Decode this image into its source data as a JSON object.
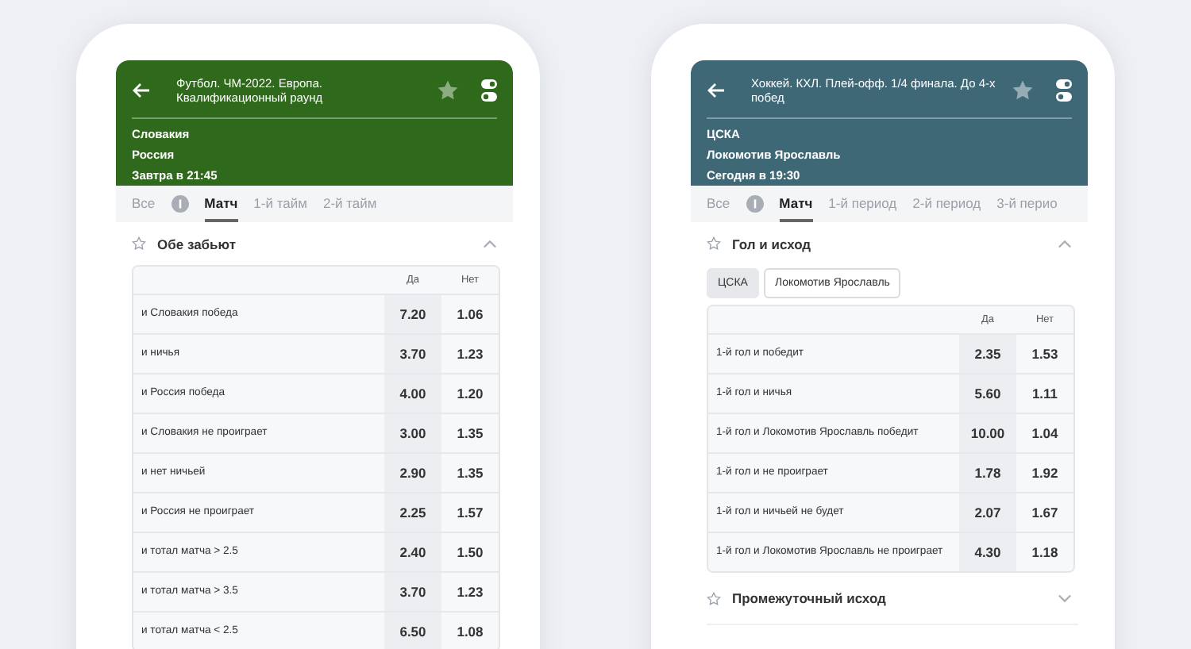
{
  "phones": [
    {
      "header": {
        "color": "#2f6a1c",
        "title": "Футбол. ЧМ-2022. Европа. Квалификационный раунд",
        "teams": [
          "Словакия",
          "Россия"
        ],
        "time": "Завтра в 21:45"
      },
      "tabs": [
        {
          "kind": "text",
          "label": "Все",
          "selected": false
        },
        {
          "kind": "icon",
          "selected": false
        },
        {
          "kind": "text",
          "label": "Матч",
          "selected": true
        },
        {
          "kind": "text",
          "label": "1-й тайм",
          "selected": false
        },
        {
          "kind": "text",
          "label": "2-й тайм",
          "selected": false
        }
      ],
      "sections": [
        {
          "title": "Обе забьют",
          "expanded": true,
          "table": {
            "columns": [
              "Да",
              "Нет"
            ],
            "rows": [
              {
                "label": "и Словакия победа",
                "values": [
                  "7.20",
                  "1.06"
                ]
              },
              {
                "label": "и ничья",
                "values": [
                  "3.70",
                  "1.23"
                ]
              },
              {
                "label": "и Россия победа",
                "values": [
                  "4.00",
                  "1.20"
                ]
              },
              {
                "label": "и Словакия не проиграет",
                "values": [
                  "3.00",
                  "1.35"
                ]
              },
              {
                "label": "и нет ничьей",
                "values": [
                  "2.90",
                  "1.35"
                ]
              },
              {
                "label": "и Россия не проиграет",
                "values": [
                  "2.25",
                  "1.57"
                ]
              },
              {
                "label": "и тотал матча > 2.5",
                "values": [
                  "2.40",
                  "1.50"
                ]
              },
              {
                "label": "и тотал матча > 3.5",
                "values": [
                  "3.70",
                  "1.23"
                ]
              },
              {
                "label": "и тотал матча < 2.5",
                "values": [
                  "6.50",
                  "1.08"
                ]
              }
            ]
          }
        }
      ]
    },
    {
      "header": {
        "color": "#3f6877",
        "title": "Хоккей. КХЛ. Плей-офф. 1/4 финала. До 4-х побед",
        "teams": [
          "ЦСКА",
          "Локомотив Ярославль"
        ],
        "time": "Сегодня в 19:30"
      },
      "tabs": [
        {
          "kind": "text",
          "label": "Все",
          "selected": false
        },
        {
          "kind": "icon",
          "selected": false
        },
        {
          "kind": "text",
          "label": "Матч",
          "selected": true
        },
        {
          "kind": "text",
          "label": "1-й период",
          "selected": false
        },
        {
          "kind": "text",
          "label": "2-й период",
          "selected": false
        },
        {
          "kind": "text",
          "label": "3-й перио",
          "selected": false
        }
      ],
      "sections": [
        {
          "title": "Гол и исход",
          "expanded": true,
          "chips": [
            {
              "label": "ЦСКА",
              "selected": true
            },
            {
              "label": "Локомотив Ярославль",
              "selected": false
            }
          ],
          "table": {
            "columns": [
              "Да",
              "Нет"
            ],
            "rows": [
              {
                "label": "1-й гол и победит",
                "values": [
                  "2.35",
                  "1.53"
                ]
              },
              {
                "label": "1-й гол и ничья",
                "values": [
                  "5.60",
                  "1.11"
                ]
              },
              {
                "label": "1-й гол и Локомотив Ярославль победит",
                "values": [
                  "10.00",
                  "1.04"
                ]
              },
              {
                "label": "1-й гол и не проиграет",
                "values": [
                  "1.78",
                  "1.92"
                ]
              },
              {
                "label": "1-й гол и ничьей не будет",
                "values": [
                  "2.07",
                  "1.67"
                ]
              },
              {
                "label": "1-й гол и Локомотив Ярославль не проиграет",
                "values": [
                  "4.30",
                  "1.18"
                ]
              }
            ]
          }
        },
        {
          "title": "Промежуточный исход",
          "expanded": false
        }
      ]
    }
  ]
}
